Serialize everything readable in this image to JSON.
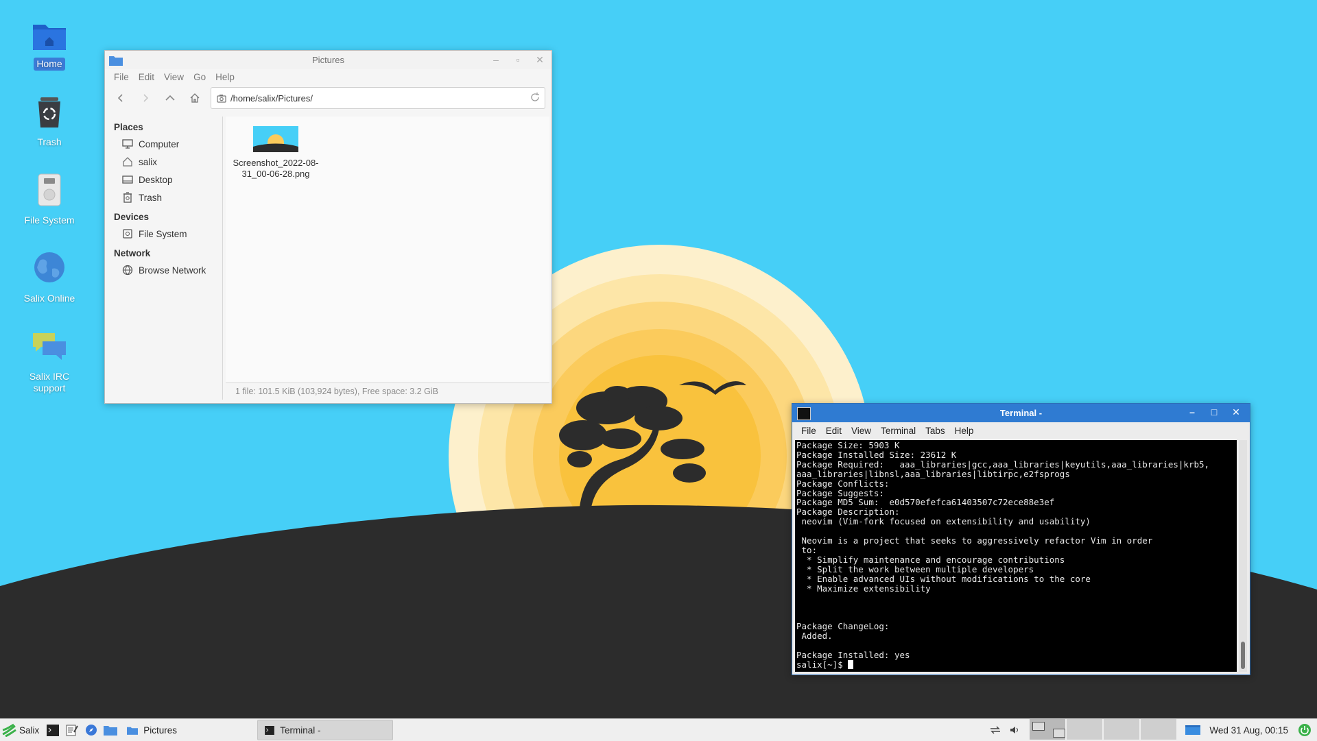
{
  "desktop": {
    "icons": [
      {
        "label": "Home"
      },
      {
        "label": "Trash"
      },
      {
        "label": "File System"
      },
      {
        "label": "Salix Online"
      },
      {
        "label": "Salix IRC support"
      }
    ]
  },
  "file_manager": {
    "title": "Pictures",
    "menu": [
      "File",
      "Edit",
      "View",
      "Go",
      "Help"
    ],
    "path": "/home/salix/Pictures/",
    "sidebar": {
      "places_header": "Places",
      "places": [
        "Computer",
        "salix",
        "Desktop",
        "Trash"
      ],
      "devices_header": "Devices",
      "devices": [
        "File System"
      ],
      "network_header": "Network",
      "network": [
        "Browse Network"
      ]
    },
    "files": [
      {
        "name_line1": "Screenshot_2022-08-",
        "name_line2": "31_00-06-28.png"
      }
    ],
    "status": "1 file: 101.5 KiB (103,924 bytes), Free space: 3.2 GiB"
  },
  "terminal": {
    "title": "Terminal -",
    "menu": [
      "File",
      "Edit",
      "View",
      "Terminal",
      "Tabs",
      "Help"
    ],
    "output": "Package Size: 5903 K\nPackage Installed Size: 23612 K\nPackage Required:   aaa_libraries|gcc,aaa_libraries|keyutils,aaa_libraries|krb5,\naaa_libraries|libnsl,aaa_libraries|libtirpc,e2fsprogs\nPackage Conflicts:\nPackage Suggests:\nPackage MD5 Sum:  e0d570efefca61403507c72ece88e3ef\nPackage Description:\n neovim (Vim-fork focused on extensibility and usability)\n\n Neovim is a project that seeks to aggressively refactor Vim in order\n to:\n  * Simplify maintenance and encourage contributions\n  * Split the work between multiple developers\n  * Enable advanced UIs without modifications to the core\n  * Maximize extensibility\n\n\n\nPackage ChangeLog:\n Added.\n\nPackage Installed: yes",
    "prompt": "salix[~]$ "
  },
  "taskbar": {
    "start_label": "Salix",
    "tasks": [
      {
        "label": "Pictures",
        "active": false
      },
      {
        "label": "Terminal -",
        "active": true
      }
    ],
    "clock": "Wed 31 Aug, 00:15"
  },
  "colors": {
    "sky": "#46cff7",
    "sun": "#f9c23d",
    "ground": "#2c2c2c",
    "terminal_title": "#2f7bd2"
  }
}
